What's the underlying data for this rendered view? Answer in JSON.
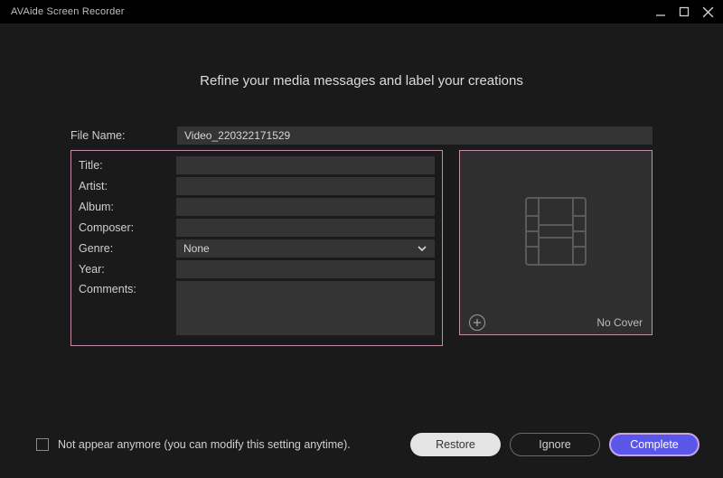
{
  "titlebar": {
    "title": "AVAide Screen Recorder"
  },
  "heading": "Refine your media messages and label your creations",
  "labels": {
    "file_name": "File Name:",
    "title": "Title:",
    "artist": "Artist:",
    "album": "Album:",
    "composer": "Composer:",
    "genre": "Genre:",
    "year": "Year:",
    "comments": "Comments:"
  },
  "fields": {
    "file_name": "Video_220322171529",
    "title": "",
    "artist": "",
    "album": "",
    "composer": "",
    "genre_selected": "None",
    "year": "",
    "comments": ""
  },
  "cover": {
    "no_cover": "No Cover"
  },
  "footer": {
    "checkbox_label": "Not appear anymore (you can modify this setting anytime).",
    "restore": "Restore",
    "ignore": "Ignore",
    "complete": "Complete"
  }
}
